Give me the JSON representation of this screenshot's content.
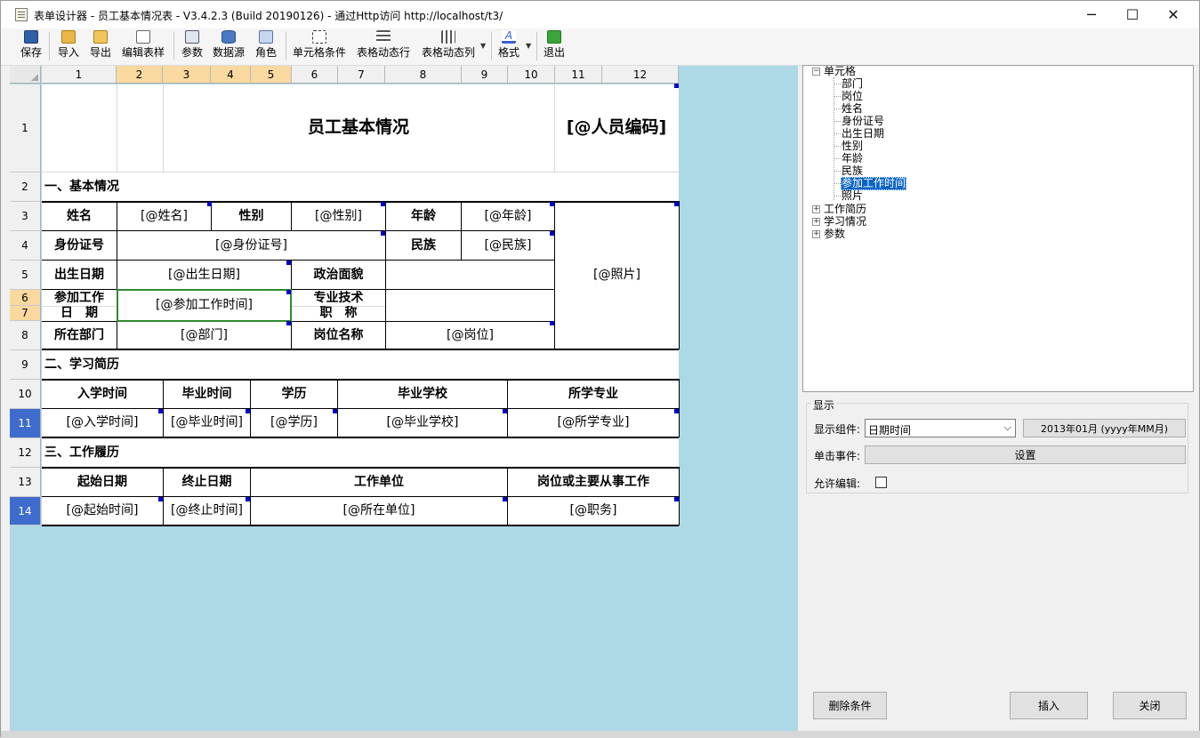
{
  "window": {
    "title": "表单设计器 - 员工基本情况表 - V3.4.2.3 (Build 20190126) - 通过Http访问 http://localhost/t3/",
    "minimize": "─",
    "maximize": "☐",
    "close": "✕"
  },
  "toolbar": {
    "save": "保存",
    "import": "导入",
    "export": "导出",
    "edit_style": "编辑表样",
    "params": "参数",
    "datasource": "数据源",
    "roles": "角色",
    "cell_condition": "单元格条件",
    "dynamic_rows": "表格动态行",
    "dynamic_cols": "表格动态列",
    "format": "格式",
    "exit": "退出"
  },
  "sheet": {
    "col_headers": [
      "1",
      "2",
      "3",
      "4",
      "5",
      "6",
      "7",
      "8",
      "9",
      "10",
      "11",
      "12"
    ],
    "row_headers": [
      "1",
      "2",
      "3",
      "4",
      "5",
      "6",
      "7",
      "8",
      "9",
      "10",
      "11",
      "12",
      "13",
      "14"
    ],
    "cells": {
      "title": "员工基本情况",
      "person_code": "[@人员编码]",
      "sec1": "一、基本情况",
      "name_lbl": "姓名",
      "name_val": "[@姓名]",
      "gender_lbl": "性别",
      "gender_val": "[@性别]",
      "age_lbl": "年龄",
      "age_val": "[@年龄]",
      "photo_val": "[@照片]",
      "id_lbl": "身份证号",
      "id_val": "[@身份证号]",
      "ethnic_lbl": "民族",
      "ethnic_val": "[@民族]",
      "birth_lbl": "出生日期",
      "birth_val": "[@出生日期]",
      "political_lbl": "政治面貌",
      "workdate_lbl1": "参加工作",
      "workdate_lbl2": "日　期",
      "workdate_val": "[@参加工作时间]",
      "title_lbl1": "专业技术",
      "title_lbl2": "职　称",
      "dept_lbl": "所在部门",
      "dept_val": "[@部门]",
      "post_lbl": "岗位名称",
      "post_val": "[@岗位]",
      "sec2": "二、学习简历",
      "enroll_lbl": "入学时间",
      "grad_lbl": "毕业时间",
      "edu_lbl": "学历",
      "school_lbl": "毕业学校",
      "major_lbl": "所学专业",
      "enroll_val": "[@入学时间]",
      "grad_val": "[@毕业时间]",
      "edu_val": "[@学历]",
      "school_val": "[@毕业学校]",
      "major_val": "[@所学专业]",
      "sec3": "三、工作履历",
      "start_lbl": "起始日期",
      "end_lbl": "终止日期",
      "unit_lbl": "工作单位",
      "job_lbl": "岗位或主要从事工作",
      "start_val": "[@起始时间]",
      "end_val": "[@终止时间]",
      "unit_val": "[@所在单位]",
      "job_val": "[@职务]"
    }
  },
  "tree": {
    "root": "单元格",
    "children": [
      "部门",
      "岗位",
      "姓名",
      "身份证号",
      "出生日期",
      "性别",
      "年龄",
      "民族",
      "参加工作时间",
      "照片"
    ],
    "selected": "参加工作时间",
    "others": [
      "工作简历",
      "学习情况",
      "参数"
    ]
  },
  "display": {
    "group_title": "显示",
    "component_label": "显示组件:",
    "component_value": "日期时间",
    "format_value": "2013年01月 (yyyy年MM月)",
    "click_label": "单击事件:",
    "click_button": "设置",
    "editable_label": "允许编辑:"
  },
  "buttons": {
    "delete_condition": "删除条件",
    "insert": "插入",
    "close": "关闭"
  }
}
